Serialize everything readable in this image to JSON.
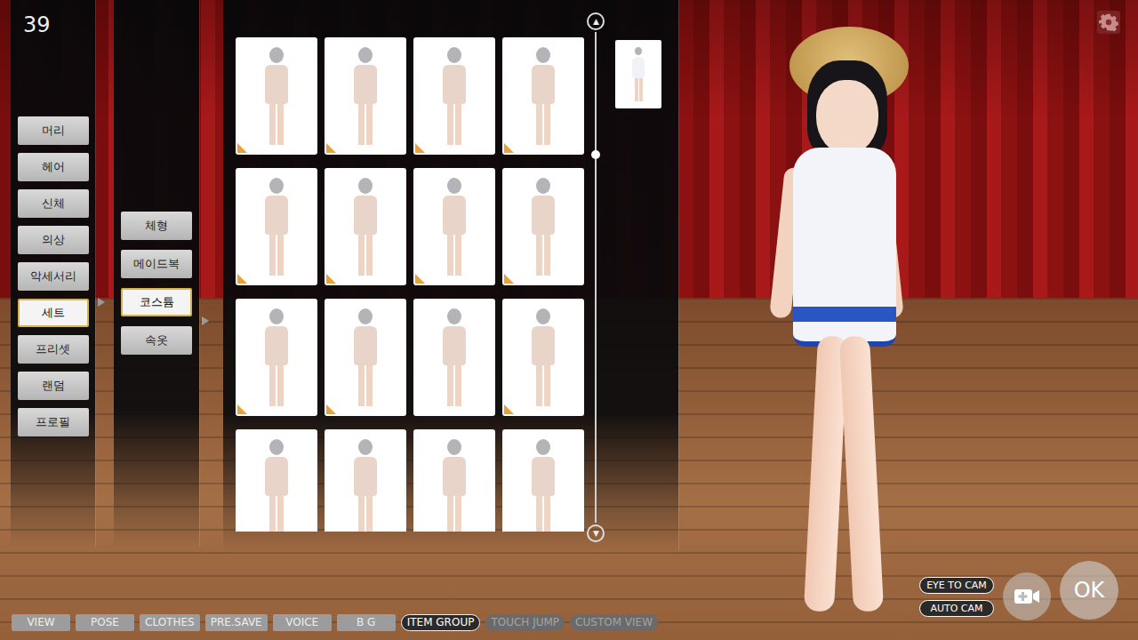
{
  "counter": "39",
  "categories": [
    {
      "label": "머리",
      "selected": false
    },
    {
      "label": "헤어",
      "selected": false
    },
    {
      "label": "신체",
      "selected": false
    },
    {
      "label": "의상",
      "selected": false
    },
    {
      "label": "악세서리",
      "selected": false
    },
    {
      "label": "세트",
      "selected": true
    },
    {
      "label": "프리셋",
      "selected": false
    },
    {
      "label": "랜덤",
      "selected": false
    },
    {
      "label": "프로필",
      "selected": false
    }
  ],
  "subcategories": [
    {
      "label": "체형",
      "selected": false
    },
    {
      "label": "메이드복",
      "selected": false
    },
    {
      "label": "코스튬",
      "selected": true
    },
    {
      "label": "속옷",
      "selected": false
    }
  ],
  "items": [
    {
      "badge": true
    },
    {
      "badge": true
    },
    {
      "badge": true
    },
    {
      "badge": true
    },
    {
      "badge": true
    },
    {
      "badge": true
    },
    {
      "badge": true
    },
    {
      "badge": true
    },
    {
      "badge": true
    },
    {
      "badge": true
    },
    {
      "badge": false
    },
    {
      "badge": true
    },
    {
      "badge": true
    },
    {
      "badge": false
    },
    {
      "badge": false
    },
    {
      "badge": true
    }
  ],
  "scroll": {
    "up": "▲",
    "down": "▼",
    "level": 0.25
  },
  "equipped": [
    {
      "kind": "costume"
    }
  ],
  "toolbar": [
    {
      "label": "VIEW",
      "kind": "plain",
      "active": false,
      "disabled": false
    },
    {
      "label": "POSE",
      "kind": "plain",
      "active": false,
      "disabled": false
    },
    {
      "label": "CLOTHES",
      "kind": "plain",
      "active": false,
      "disabled": false
    },
    {
      "label": "PRE.SAVE",
      "kind": "plain",
      "active": false,
      "disabled": false
    },
    {
      "label": "VOICE",
      "kind": "plain",
      "active": false,
      "disabled": false
    },
    {
      "label": "B G",
      "kind": "plain",
      "active": false,
      "disabled": false
    },
    {
      "label": "ITEM GROUP",
      "kind": "toggle",
      "active": true,
      "disabled": false
    },
    {
      "label": "TOUCH JUMP",
      "kind": "toggle",
      "active": false,
      "disabled": true
    },
    {
      "label": "CUSTOM VIEW",
      "kind": "toggle",
      "active": false,
      "disabled": true
    }
  ],
  "camera_toggles": [
    {
      "label": "EYE TO CAM"
    },
    {
      "label": "AUTO CAM"
    }
  ],
  "ok": "OK"
}
